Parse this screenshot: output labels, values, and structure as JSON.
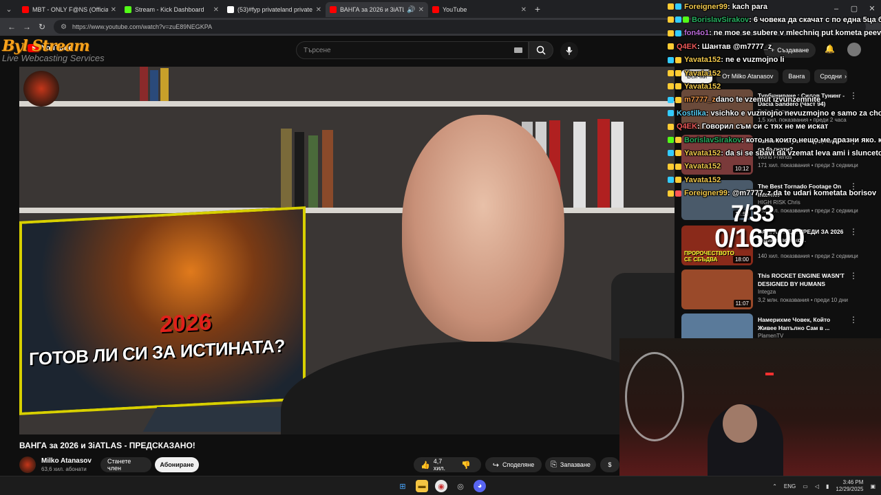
{
  "browser": {
    "tabs": [
      {
        "label": "MBT - ONLY F@NS (Official Au",
        "color": "#ff0000",
        "active": false
      },
      {
        "label": "Stream - Kick Dashboard",
        "color": "#53fc18",
        "active": false
      },
      {
        "label": "(53)#fyp privateland private ru",
        "color": "#ffffff",
        "active": false
      },
      {
        "label": "ВАНГА за 2026 и 3iATLAS",
        "color": "#ff0000",
        "active": true
      },
      {
        "label": "YouTube",
        "color": "#ff0000",
        "active": false
      }
    ],
    "url": "https://www.youtube.com/watch?v=zuE89NEGKPA"
  },
  "overlay_brand": {
    "name": "Byl   Stream",
    "subtitle": "Live Webcasting Services",
    "youtube_word": "YouTube"
  },
  "youtube": {
    "search_placeholder": "Търсене",
    "create_label": "Създаване",
    "video": {
      "title": "ВАНГА за 2026 и 3iATLAS - ПРЕДСКАЗАНО!",
      "thumbnail_year": "2026",
      "thumbnail_text": "ГОТОВ ЛИ СИ ЗА ИСТИНАТА?"
    },
    "channel": {
      "name": "Milko Atanasov",
      "subs": "63,6 хил. абонати",
      "join_label": "Станете член",
      "subscribe_label": "Абониране"
    },
    "actions": {
      "likes": "4,7 хил.",
      "share": "Споделяне",
      "save": "Запазване"
    },
    "chips": [
      "Всички",
      "От Milko Atanasov",
      "Ванга",
      "Сродни"
    ],
    "recommendations": [
      {
        "title": "Турбиниране : Силов Тунинг - Dacia Sandero (Част 94)",
        "channel": "Delica-Supra",
        "meta": "1,5 хил. показвания • преди 2 часа",
        "duration": "",
        "thumb": "#6a4a3a"
      },
      {
        "title": "Какво се случи с хора, които са бъгнати?",
        "channel": "World Friends",
        "meta": "171 хил. показвания • преди 3 седмици",
        "duration": "10:12",
        "thumb": "#7a3a3a"
      },
      {
        "title": "The Best Tornado Footage On Internet",
        "channel": "HIGH RISK Chris",
        "meta": "152 хил. показвания • преди 2 седмици",
        "duration": "16:53",
        "thumb": "#4a5a6a"
      },
      {
        "title": "ВАНГА ПРЕДУПРЕДИ ЗА 2026 година, всичко...",
        "channel": "",
        "meta": "140 хил. показвания • преди 2 седмици",
        "duration": "18:00",
        "thumb": "#8a2a1a",
        "thumb_text": "ПРОРОЧЕСТВОТО СЕ СБЪДВА"
      },
      {
        "title": "This ROCKET ENGINE WASN'T DESIGNED BY HUMANS",
        "channel": "Integza",
        "meta": "3,2 млн. показвания • преди 10 дни",
        "duration": "11:07",
        "thumb": "#9a4a2a"
      },
      {
        "title": "Намерихме Човек, Който Живее Напълно Сам в ...",
        "channel": "PlamenTV",
        "meta": "",
        "duration": "",
        "thumb": "#5a7a9a",
        "thumb_text": "1 ЖИТЕЛ?!"
      }
    ]
  },
  "chat": [
    {
      "user": "Foreigner99",
      "msg": " : kach para",
      "color": "#f2c94c",
      "badges": [
        "#ffcc33",
        "#33ccff"
      ]
    },
    {
      "user": "BorislavSirakov",
      "msg": " : 6 човека да скачат с по една 5ца бърже",
      "color": "#27ae60",
      "badges": [
        "#ffcc33",
        "#33ccff",
        "#53fc18"
      ]
    },
    {
      "user": "fon4o1",
      "msg": " : ne moe se subere v mlechniq put kometa peevski",
      "color": "#bb6bd9",
      "badges": [
        "#ffcc33",
        "#33ccff"
      ]
    },
    {
      "user": "Q4EK",
      "msg": " : Шантав @m7777_z",
      "color": "#eb5757",
      "badges": [
        "#ffcc33"
      ]
    },
    {
      "user": "Yavata152",
      "msg": " : ne e vuzmojno li",
      "color": "#f2c94c",
      "badges": [
        "#33ccff",
        "#ffcc33"
      ]
    },
    {
      "user": "Yavata152",
      "msg": "",
      "color": "#f2c94c",
      "badges": [
        "#ffcc33",
        "#ffcc33"
      ]
    },
    {
      "user": "Yavata152",
      "msg": "",
      "color": "#f2c94c",
      "badges": [
        "#ffcc33",
        "#ffcc33"
      ]
    },
    {
      "user": "m7777_z",
      "msg": " dano te vzemut izvunzemnite",
      "color": "#f2994a",
      "badges": [
        "#33ccff",
        "#ffcc33"
      ]
    },
    {
      "user": "Kostilka",
      "msg": " : vsichko e vuzmojno nevuzmojno e samo za chovek bez",
      "color": "#56ccf2",
      "badges": [
        "#33ccff"
      ]
    },
    {
      "user": "Q4EK",
      "msg": " : Говорил съм си с тях не ме искат",
      "color": "#eb5757",
      "badges": [
        "#ffcc33"
      ]
    },
    {
      "user": "BorislavSirakov",
      "msg": " : кото на които нещо ме дразни яко. които",
      "color": "#27ae60",
      "badges": [
        "#53fc18",
        "#ffcc33"
      ]
    },
    {
      "user": "Yavata152",
      "msg": " : da si se sbavi da vzemat leva ami i slunceto",
      "color": "#f2c94c",
      "badges": [
        "#33ccff",
        "#ffcc33"
      ]
    },
    {
      "user": "Yavata152",
      "msg": "",
      "color": "#f2c94c",
      "badges": [
        "#ffcc33",
        "#ffcc33"
      ]
    },
    {
      "user": "Yavata152",
      "msg": "",
      "color": "#f2c94c",
      "badges": [
        "#33ccff",
        "#ffcc33"
      ]
    },
    {
      "user": "Foreigner99",
      "msg": " : @m7777_z da te udari kometata borisov",
      "color": "#f2c94c",
      "badges": [
        "#ffcc33",
        "#ff5555"
      ]
    }
  ],
  "goal": {
    "top": "7/33",
    "bottom": "0/16500"
  },
  "taskbar": {
    "lang": "ENG",
    "time": "3:46 PM",
    "date": "12/29/2025"
  }
}
